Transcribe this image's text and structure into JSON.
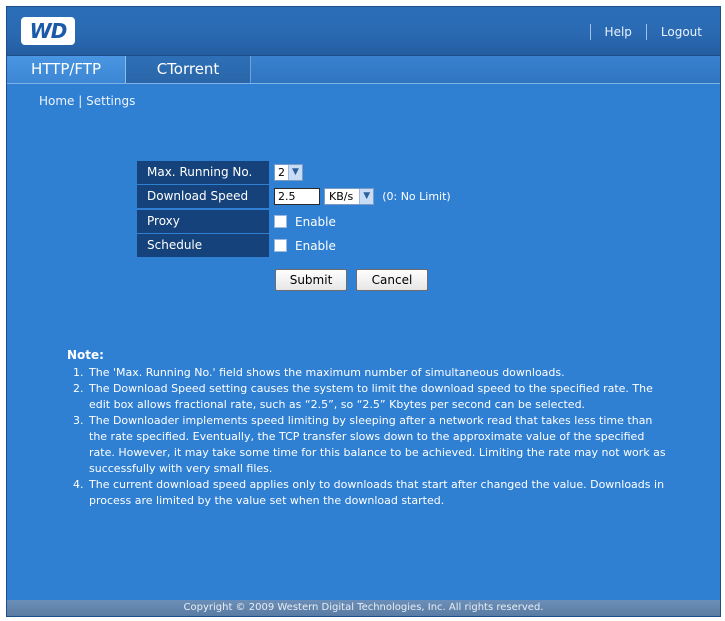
{
  "header": {
    "logo_text": "WD",
    "links": [
      "Help",
      "Logout"
    ]
  },
  "tabs": [
    {
      "label": "HTTP/FTP",
      "active": true
    },
    {
      "label": "CTorrent",
      "active": false
    }
  ],
  "breadcrumb": {
    "home": "Home",
    "separator": "|",
    "current": "Settings"
  },
  "form": {
    "max_running": {
      "label": "Max. Running No.",
      "value": "2"
    },
    "download_speed": {
      "label": "Download Speed",
      "value": "2.5",
      "unit": "KB/s",
      "hint": "(0: No Limit)"
    },
    "proxy": {
      "label": "Proxy",
      "checkbox_label": "Enable",
      "checked": false
    },
    "schedule": {
      "label": "Schedule",
      "checkbox_label": "Enable",
      "checked": false
    },
    "submit_label": "Submit",
    "cancel_label": "Cancel"
  },
  "notes": {
    "title": "Note:",
    "items": [
      "The 'Max. Running No.' field shows the maximum number of simultaneous downloads.",
      "The Download Speed setting causes the system to limit the download speed to the specified rate. The edit box allows fractional rate, such as “2.5”, so “2.5” Kbytes per second can be selected.",
      "The Downloader implements speed limiting by sleeping after a network read that takes less time than the rate specified. Eventually, the TCP transfer slows down to the approximate value of the specified rate. However, it may take some time for this balance to be achieved. Limiting the rate may not work as successfully with very small files.",
      "The current download speed applies only to downloads that start after changed the value. Downloads in process are limited by the value set when the download started."
    ]
  },
  "footer": {
    "copyright": "Copyright © 2009 Western Digital Technologies, Inc. All rights reserved."
  },
  "colors": {
    "background": "#2f7fd3",
    "label_bg": "#15427a",
    "header": "#2a6ab3"
  }
}
